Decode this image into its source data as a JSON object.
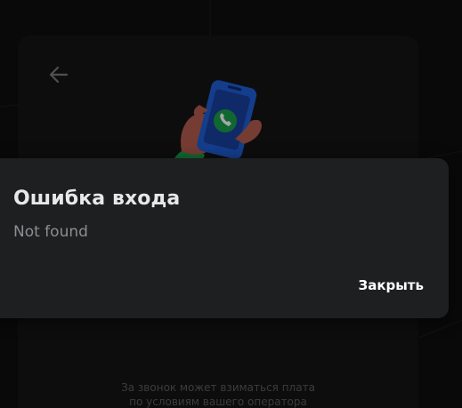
{
  "dialog": {
    "title": "Ошибка входа",
    "message": "Not found",
    "close_label": "Закрыть"
  },
  "login": {
    "footer_line1": "За звонок может взиматься плата",
    "footer_line2": "по условиям вашего оператора"
  },
  "icons": {
    "back": "arrow-left-icon",
    "illustration": "phone-call-illustration"
  },
  "colors": {
    "dialog_bg": "#1e1f20",
    "phone_blue": "#1f5fd6",
    "call_green": "#1aa04a"
  }
}
